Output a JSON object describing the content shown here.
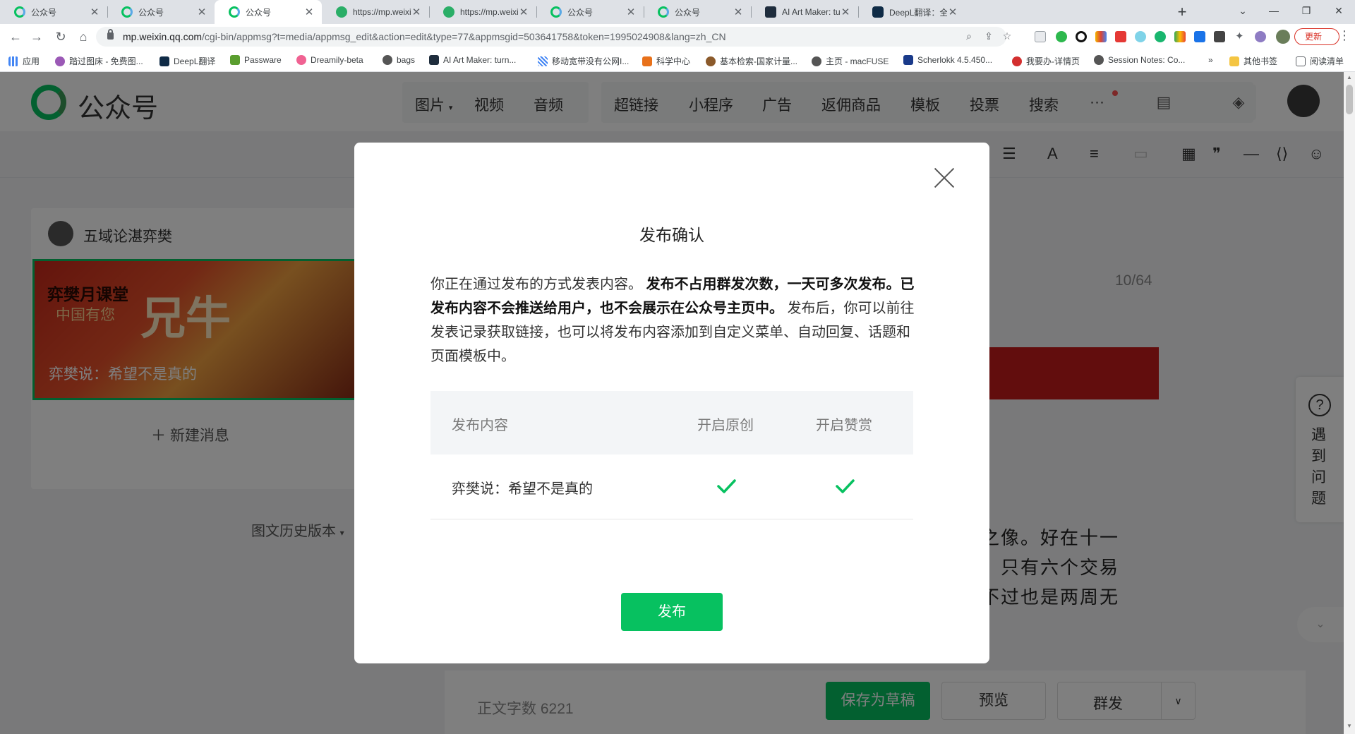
{
  "browser": {
    "tabs": [
      {
        "title": "公众号",
        "icon": "wechat-mp-icon"
      },
      {
        "title": "公众号",
        "icon": "wechat-mp-icon"
      },
      {
        "title": "公众号",
        "icon": "wechat-mp-icon",
        "active": true
      },
      {
        "title": "https://mp.weixin.qq",
        "icon": "wechat-icon"
      },
      {
        "title": "https://mp.weixin.qq",
        "icon": "wechat-icon"
      },
      {
        "title": "公众号",
        "icon": "wechat-mp-icon"
      },
      {
        "title": "公众号",
        "icon": "wechat-mp-icon"
      },
      {
        "title": "AI Art Maker: turn te",
        "icon": "ai-art-icon"
      },
      {
        "title": "DeepL翻译：全世界最",
        "icon": "deepl-icon"
      }
    ],
    "url_host": "mp.weixin.qq.com",
    "url_path": "/cgi-bin/appmsg?t=media/appmsg_edit&action=edit&type=77&appmsgid=503641758&token=1995024908&lang=zh_CN",
    "update_label": "更新",
    "bookmarks": [
      "应用",
      "踏过图床 - 免费图...",
      "DeepL翻译",
      "Passware",
      "Dreamily-beta",
      "bags",
      "AI Art Maker: turn...",
      "移动宽带没有公网I...",
      "科学中心",
      "基本检索-国家计量...",
      "主页 - macFUSE",
      "Scherlokk 4.5.450...",
      "我要办-详情页",
      "Session Notes: Co...",
      "»",
      "其他书签",
      "阅读清单"
    ]
  },
  "app": {
    "logo_text": "公众号",
    "menu": [
      "图片",
      "视频",
      "音频",
      "超链接",
      "小程序",
      "广告",
      "返佣商品",
      "模板",
      "投票",
      "搜索",
      "···"
    ],
    "author_name": "五域论湛弈樊",
    "cover_calligraphy_1": "弈樊月课堂",
    "cover_calligraphy_2": "中国有您",
    "cover_calligraphy_big": "兄牛",
    "cover_title": "弈樊说：希望不是真的",
    "new_message": "新建消息",
    "history": "图文历史版本",
    "title_count": "10/64",
    "article_lines": [
      "弱之像。好在十一",
      "国，只有六个交易",
      "，不过也是两周无"
    ],
    "word_count_label": "正文字数",
    "word_count": "6221",
    "save_draft": "保存为草稿",
    "preview": "预览",
    "mass_send": "群发",
    "help_label": "遇到问题"
  },
  "modal": {
    "title": "发布确认",
    "desc_pre": "你正在通过发布的方式发表内容。",
    "desc_bold": "发布不占用群发次数，一天可多次发布。已发布内容不会推送给用户，也不会展示在公众号主页中。",
    "desc_post": "发布后，你可以前往发表记录获取链接，也可以将发布内容添加到自定义菜单、自动回复、话题和页面模板中。",
    "table": {
      "headers": [
        "发布内容",
        "开启原创",
        "开启赞赏"
      ],
      "rows": [
        {
          "name": "弈樊说：希望不是真的",
          "original": true,
          "reward": true
        }
      ]
    },
    "publish_button": "发布",
    "accent": "#07c160"
  }
}
